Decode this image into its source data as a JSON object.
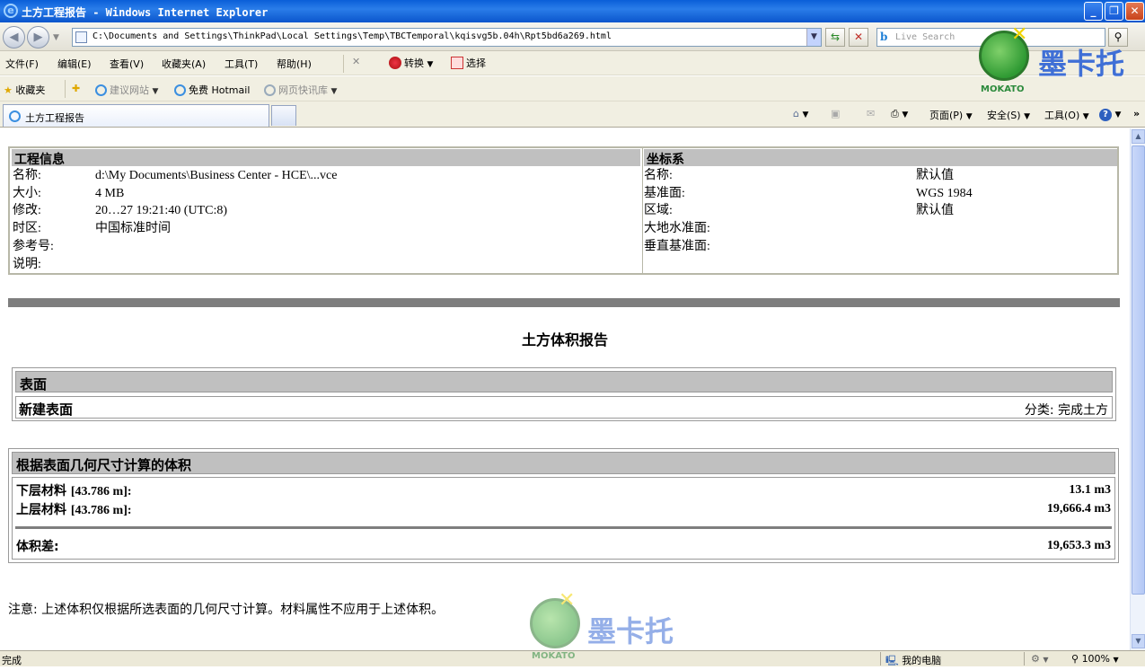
{
  "window": {
    "title": "土方工程报告 - Windows Internet Explorer"
  },
  "address": {
    "url": "C:\\Documents and Settings\\ThinkPad\\Local Settings\\Temp\\TBCTemporal\\kqisvg5b.04h\\Rpt5bd6a269.html",
    "search_placeholder": "Live Search"
  },
  "menu": [
    "文件(F)",
    "编辑(E)",
    "查看(V)",
    "收藏夹(A)",
    "工具(T)",
    "帮助(H)"
  ],
  "toolbar": {
    "convert": "转换",
    "select": "选择"
  },
  "favorites": {
    "label": "收藏夹",
    "items": [
      "建议网站",
      "免费 Hotmail",
      "网页快讯库"
    ]
  },
  "tabs": {
    "active": "土方工程报告"
  },
  "commands": {
    "page": "页面(P)",
    "safety": "安全(S)",
    "tools": "工具(O)"
  },
  "report": {
    "project": {
      "header": "工程信息",
      "rows": [
        {
          "label": "名称:",
          "value": "d:\\My Documents\\Business Center - HCE\\...vce"
        },
        {
          "label": "大小:",
          "value": "4 MB"
        },
        {
          "label": "修改:",
          "value": "20…27 19:21:40 (UTC:8)"
        },
        {
          "label": "时区:",
          "value": "中国标准时间"
        },
        {
          "label": "参考号:",
          "value": ""
        },
        {
          "label": "说明:",
          "value": ""
        }
      ]
    },
    "coord": {
      "header": "坐标系",
      "rows": [
        {
          "label": "名称:",
          "value": "默认值"
        },
        {
          "label": "基准面:",
          "value": "WGS 1984"
        },
        {
          "label": "区域:",
          "value": "默认值"
        },
        {
          "label": "大地水准面:",
          "value": ""
        },
        {
          "label": "垂直基准面:",
          "value": ""
        }
      ]
    },
    "title": "土方体积报告",
    "surface": {
      "header": "表面",
      "name": "新建表面",
      "category": "分类: 完成土方"
    },
    "volume": {
      "header": "根据表面几何尺寸计算的体积",
      "lower_label": "下层材料",
      "lower_extra": "[43.786 m]:",
      "lower_value": "13.1 m3",
      "upper_label": "上层材料",
      "upper_extra": "[43.786 m]:",
      "upper_value": "19,666.4 m3",
      "diff_label": "体积差:",
      "diff_value": "19,653.3 m3"
    },
    "note": "注意: 上述体积仅根据所选表面的几何尺寸计算。材料属性不应用于上述体积。"
  },
  "status": {
    "left": "完成",
    "zone": "我的电脑",
    "zoom": "100%"
  },
  "watermark": {
    "text": "墨卡托",
    "sub": "MOKATO"
  }
}
